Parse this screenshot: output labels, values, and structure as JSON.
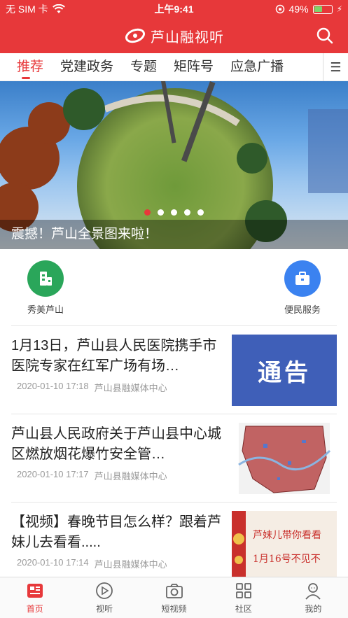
{
  "status": {
    "carrier": "无 SIM 卡",
    "time": "上午9:41",
    "battery": "49%",
    "battery_level": 0.49
  },
  "header": {
    "brand": "芦山融视听",
    "brand_color": "#e7383a"
  },
  "tabs": [
    {
      "label": "推荐",
      "active": true
    },
    {
      "label": "党建政务"
    },
    {
      "label": "专题"
    },
    {
      "label": "矩阵号"
    },
    {
      "label": "应急广播"
    }
  ],
  "banner": {
    "caption": "震撼！芦山全景图来啦！",
    "slide_count": 5,
    "active_slide": 1
  },
  "shortcuts": [
    {
      "label": "秀美芦山",
      "icon": "building-icon",
      "color": "#2aa65a"
    },
    {
      "label": "便民服务",
      "icon": "briefcase-icon",
      "color": "#3b82f0"
    }
  ],
  "news": [
    {
      "title": "1月13日，芦山县人民医院携手市医院专家在红军广场有场…",
      "date": "2020-01-10 17:18",
      "source": "芦山县融媒体中心",
      "thumb_text": "通告"
    },
    {
      "title": "芦山县人民政府关于芦山县中心城区燃放烟花爆竹安全管…",
      "date": "2020-01-10 17:17",
      "source": "芦山县融媒体中心"
    },
    {
      "title": "【视频】春晚节目怎么样？跟着芦妹儿去看看.....",
      "date": "2020-01-10 17:14",
      "source": "芦山县融媒体中心",
      "thumb_text_1": "芦妹儿带你看看",
      "thumb_text_2": "1月16号不见不"
    }
  ],
  "bottom_nav": [
    {
      "label": "首页",
      "active": true
    },
    {
      "label": "视听"
    },
    {
      "label": "短视频"
    },
    {
      "label": "社区"
    },
    {
      "label": "我的"
    }
  ]
}
